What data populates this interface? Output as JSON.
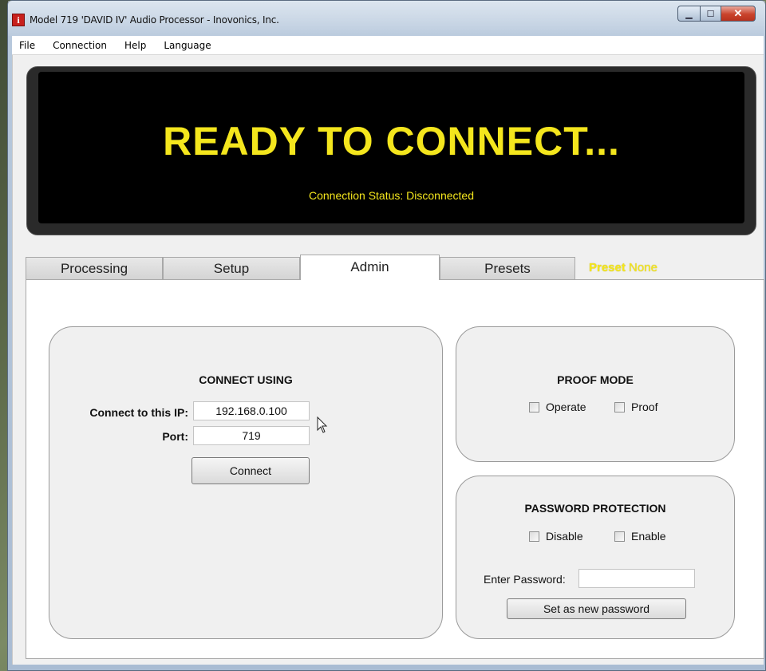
{
  "window": {
    "title": "Model 719 'DAVID IV' Audio Processor - Inovonics, Inc.",
    "app_icon": "i"
  },
  "menubar": {
    "items": [
      "File",
      "Connection",
      "Help",
      "Language"
    ]
  },
  "display": {
    "headline": "READY TO CONNECT...",
    "status": "Connection Status: Disconnected"
  },
  "tabs": [
    "Processing",
    "Setup",
    "Admin",
    "Presets"
  ],
  "active_tab": "Admin",
  "preset": {
    "label": "Preset",
    "value": "None"
  },
  "connect": {
    "title": "CONNECT USING",
    "ip_label": "Connect to this IP:",
    "ip_value": "192.168.0.100",
    "port_label": "Port:",
    "port_value": "719",
    "button": "Connect"
  },
  "proof_mode": {
    "title": "PROOF MODE",
    "options": [
      "Operate",
      "Proof"
    ]
  },
  "password": {
    "title": "PASSWORD PROTECTION",
    "options": [
      "Disable",
      "Enable"
    ],
    "enter_label": "Enter Password:",
    "enter_value": "",
    "button": "Set as new password"
  },
  "colors": {
    "display_text": "#f4e61d",
    "display_bg": "#000000"
  }
}
